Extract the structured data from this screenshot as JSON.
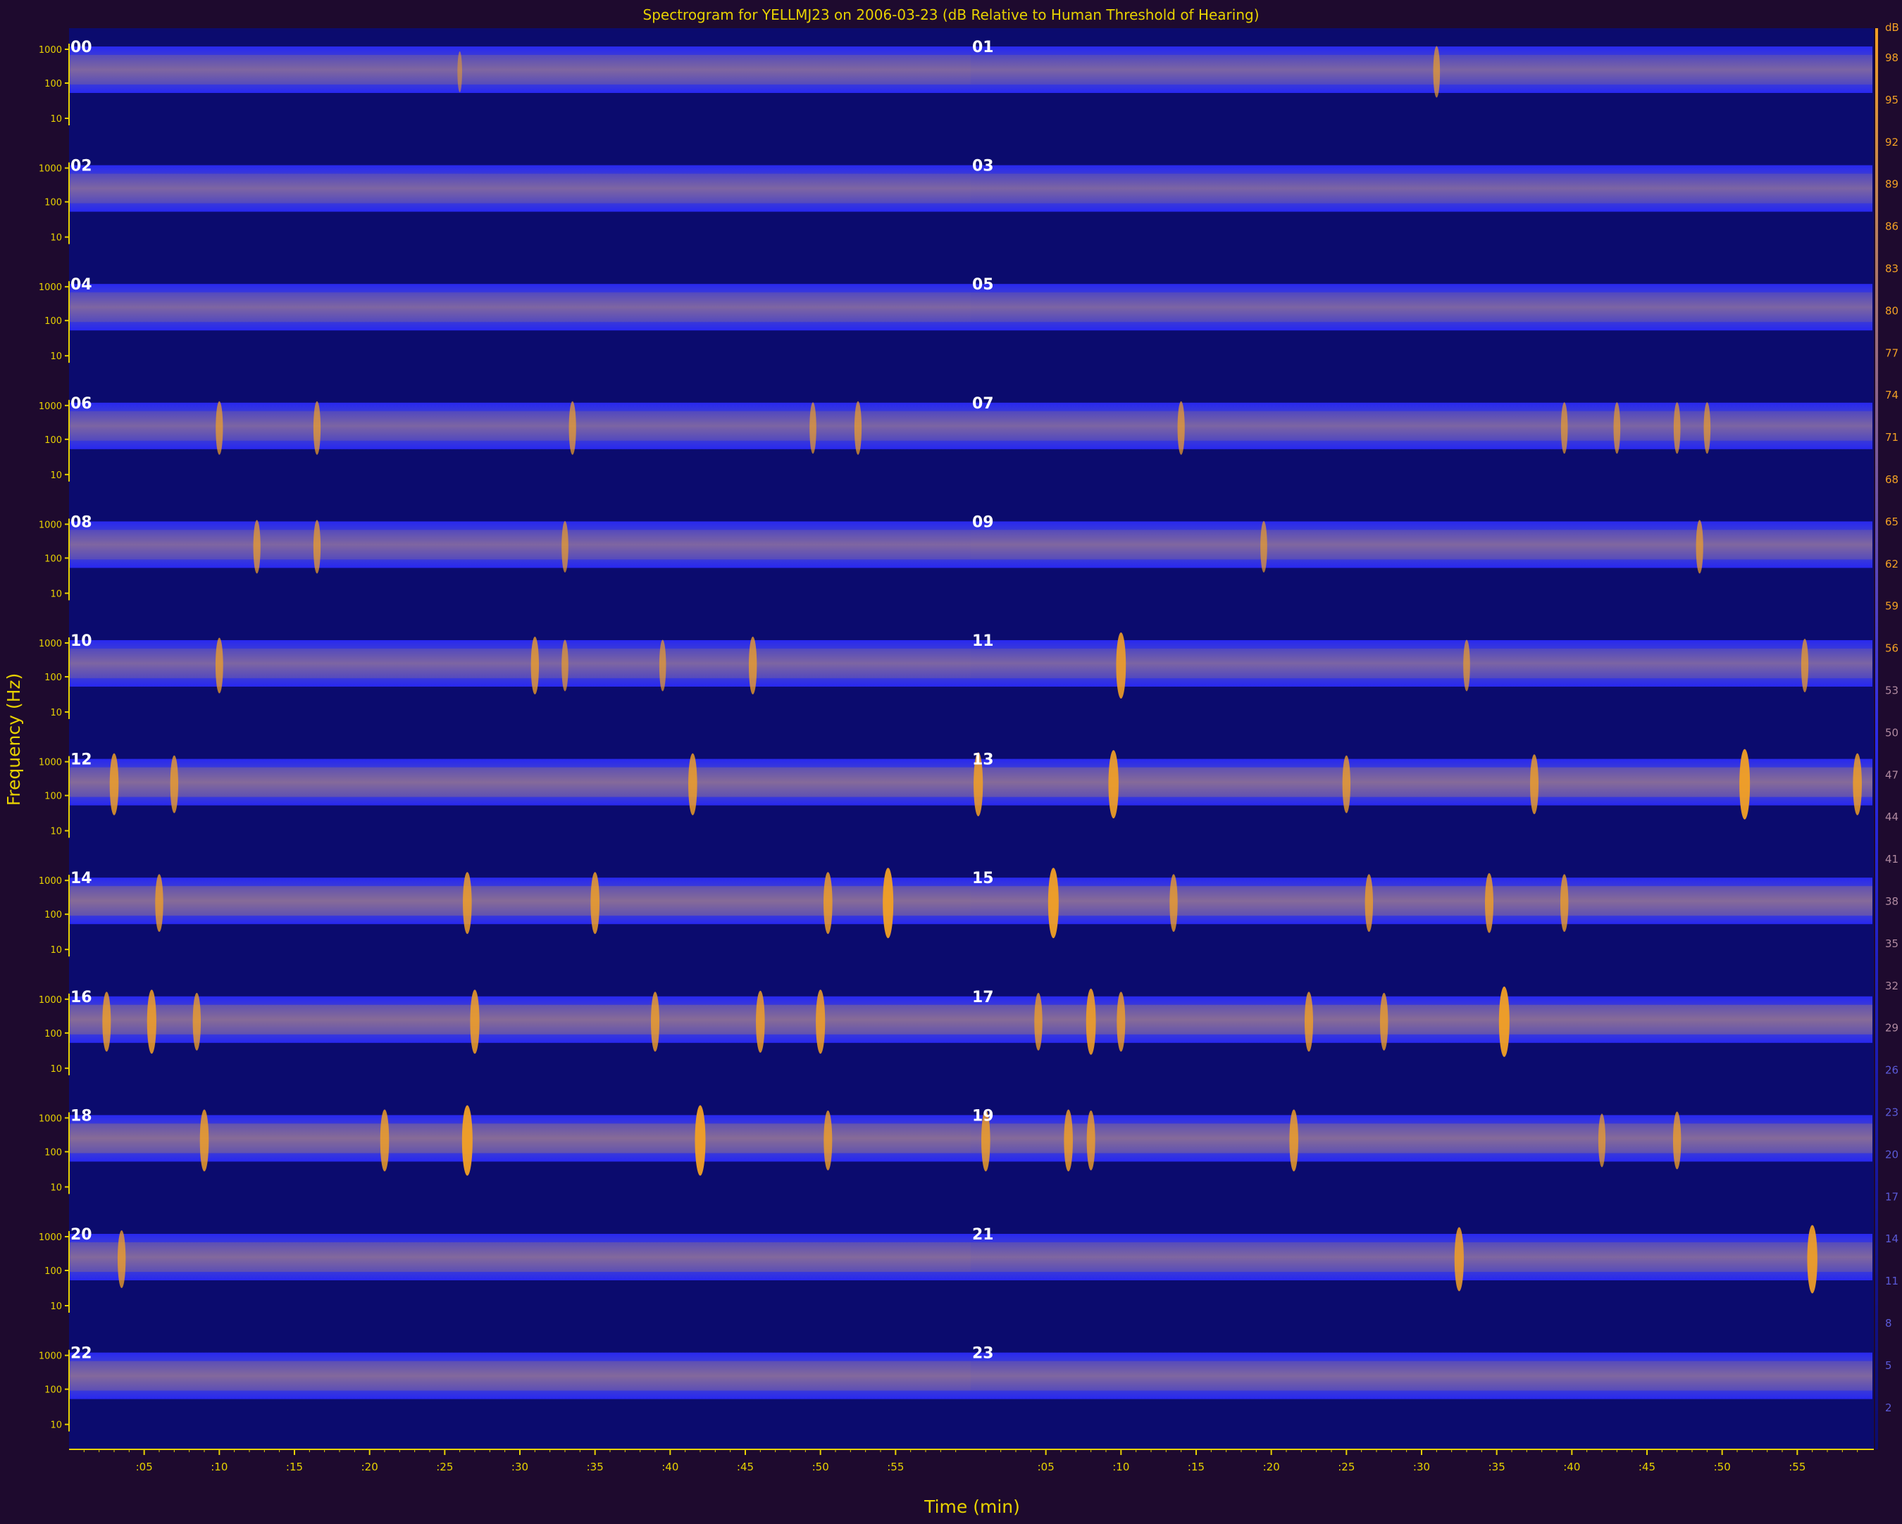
{
  "chart_data": {
    "type": "heatmap",
    "title": "Spectrogram for YELLMJ23 on 2006-03-23 (dB Relative to Human Threshold of Hearing)",
    "xlabel": "Time (min)",
    "ylabel": "Frequency (Hz)",
    "x_tick_labels": [
      ":05",
      ":10",
      ":15",
      ":20",
      ":25",
      ":30",
      ":35",
      ":40",
      ":45",
      ":50",
      ":55",
      ":05",
      ":10",
      ":15",
      ":20",
      ":25",
      ":30",
      ":35",
      ":40",
      ":45",
      ":50",
      ":55"
    ],
    "y_tick_labels": [
      "1000",
      "100",
      "10"
    ],
    "colorbar_label": "dB",
    "colorbar_ticks": [
      98,
      95,
      92,
      89,
      86,
      83,
      80,
      77,
      74,
      71,
      68,
      65,
      62,
      59,
      56,
      53,
      50,
      47,
      44,
      41,
      38,
      35,
      32,
      29,
      26,
      23,
      20,
      17,
      14,
      11,
      8,
      5,
      2
    ],
    "colorscale": {
      "low": "#0b0b6e",
      "mid": "#2a2ae8",
      "high": "#f2a024"
    },
    "hours": [
      "00",
      "01",
      "02",
      "03",
      "04",
      "05",
      "06",
      "07",
      "08",
      "09",
      "10",
      "11",
      "12",
      "13",
      "14",
      "15",
      "16",
      "17",
      "18",
      "19",
      "20",
      "21",
      "22",
      "23"
    ],
    "hour_band_level": [
      0.45,
      0.38,
      0.4,
      0.38,
      0.4,
      0.38,
      0.38,
      0.38,
      0.42,
      0.44,
      0.4,
      0.38,
      0.55,
      0.58,
      0.6,
      0.58,
      0.6,
      0.6,
      0.6,
      0.55,
      0.5,
      0.45,
      0.5,
      0.45
    ],
    "events": [
      {
        "hour": "00",
        "minute": 26,
        "level": 0.3
      },
      {
        "hour": "01",
        "minute": 31,
        "level": 0.55
      },
      {
        "hour": "06",
        "minute": 10,
        "level": 0.6
      },
      {
        "hour": "06",
        "minute": 16.5,
        "level": 0.6
      },
      {
        "hour": "06",
        "minute": 33.5,
        "level": 0.6
      },
      {
        "hour": "06",
        "minute": 49.5,
        "level": 0.55
      },
      {
        "hour": "06",
        "minute": 52.5,
        "level": 0.6
      },
      {
        "hour": "07",
        "minute": 14,
        "level": 0.6
      },
      {
        "hour": "07",
        "minute": 39.5,
        "level": 0.55
      },
      {
        "hour": "07",
        "minute": 43,
        "level": 0.55
      },
      {
        "hour": "07",
        "minute": 47,
        "level": 0.55
      },
      {
        "hour": "07",
        "minute": 49,
        "level": 0.55
      },
      {
        "hour": "08",
        "minute": 12.5,
        "level": 0.6
      },
      {
        "hour": "08",
        "minute": 16.5,
        "level": 0.6
      },
      {
        "hour": "08",
        "minute": 33,
        "level": 0.55
      },
      {
        "hour": "09",
        "minute": 19.5,
        "level": 0.55
      },
      {
        "hour": "09",
        "minute": 48.5,
        "level": 0.6
      },
      {
        "hour": "10",
        "minute": 10,
        "level": 0.65
      },
      {
        "hour": "10",
        "minute": 31,
        "level": 0.7
      },
      {
        "hour": "10",
        "minute": 33,
        "level": 0.55
      },
      {
        "hour": "10",
        "minute": 39.5,
        "level": 0.55
      },
      {
        "hour": "10",
        "minute": 45.5,
        "level": 0.7
      },
      {
        "hour": "11",
        "minute": 10,
        "level": 0.9
      },
      {
        "hour": "11",
        "minute": 33,
        "level": 0.55
      },
      {
        "hour": "11",
        "minute": 55.5,
        "level": 0.6
      },
      {
        "hour": "12",
        "minute": 3,
        "level": 0.8
      },
      {
        "hour": "12",
        "minute": 7,
        "level": 0.7
      },
      {
        "hour": "12",
        "minute": 41.5,
        "level": 0.8
      },
      {
        "hour": "13",
        "minute": 0.5,
        "level": 0.85
      },
      {
        "hour": "13",
        "minute": 9.5,
        "level": 0.95
      },
      {
        "hour": "13",
        "minute": 25,
        "level": 0.7
      },
      {
        "hour": "13",
        "minute": 37.5,
        "level": 0.75
      },
      {
        "hour": "13",
        "minute": 51.5,
        "level": 1.0
      },
      {
        "hour": "13",
        "minute": 59,
        "level": 0.8
      },
      {
        "hour": "14",
        "minute": 6,
        "level": 0.7
      },
      {
        "hour": "14",
        "minute": 26.5,
        "level": 0.8
      },
      {
        "hour": "14",
        "minute": 35,
        "level": 0.8
      },
      {
        "hour": "14",
        "minute": 50.5,
        "level": 0.8
      },
      {
        "hour": "14",
        "minute": 54.5,
        "level": 1.0
      },
      {
        "hour": "15",
        "minute": 5.5,
        "level": 1.0
      },
      {
        "hour": "15",
        "minute": 13.5,
        "level": 0.7
      },
      {
        "hour": "15",
        "minute": 26.5,
        "level": 0.7
      },
      {
        "hour": "15",
        "minute": 34.5,
        "level": 0.75
      },
      {
        "hour": "15",
        "minute": 39.5,
        "level": 0.7
      },
      {
        "hour": "16",
        "minute": 2.5,
        "level": 0.75
      },
      {
        "hour": "16",
        "minute": 5.5,
        "level": 0.85
      },
      {
        "hour": "16",
        "minute": 8.5,
        "level": 0.7
      },
      {
        "hour": "16",
        "minute": 27,
        "level": 0.85
      },
      {
        "hour": "16",
        "minute": 39,
        "level": 0.75
      },
      {
        "hour": "16",
        "minute": 46,
        "level": 0.8
      },
      {
        "hour": "16",
        "minute": 50,
        "level": 0.85
      },
      {
        "hour": "17",
        "minute": 4.5,
        "level": 0.7
      },
      {
        "hour": "17",
        "minute": 8,
        "level": 0.9
      },
      {
        "hour": "17",
        "minute": 10,
        "level": 0.75
      },
      {
        "hour": "17",
        "minute": 22.5,
        "level": 0.75
      },
      {
        "hour": "17",
        "minute": 27.5,
        "level": 0.7
      },
      {
        "hour": "17",
        "minute": 35.5,
        "level": 1.0
      },
      {
        "hour": "18",
        "minute": 9,
        "level": 0.8
      },
      {
        "hour": "18",
        "minute": 21,
        "level": 0.8
      },
      {
        "hour": "18",
        "minute": 26.5,
        "level": 1.0
      },
      {
        "hour": "18",
        "minute": 42,
        "level": 1.0
      },
      {
        "hour": "18",
        "minute": 50.5,
        "level": 0.75
      },
      {
        "hour": "19",
        "minute": 1,
        "level": 0.8
      },
      {
        "hour": "19",
        "minute": 6.5,
        "level": 0.8
      },
      {
        "hour": "19",
        "minute": 8,
        "level": 0.75
      },
      {
        "hour": "19",
        "minute": 21.5,
        "level": 0.8
      },
      {
        "hour": "19",
        "minute": 42,
        "level": 0.6
      },
      {
        "hour": "19",
        "minute": 47,
        "level": 0.7
      },
      {
        "hour": "20",
        "minute": 3.5,
        "level": 0.7
      },
      {
        "hour": "21",
        "minute": 32.5,
        "level": 0.85
      },
      {
        "hour": "21",
        "minute": 56,
        "level": 0.95
      }
    ]
  }
}
